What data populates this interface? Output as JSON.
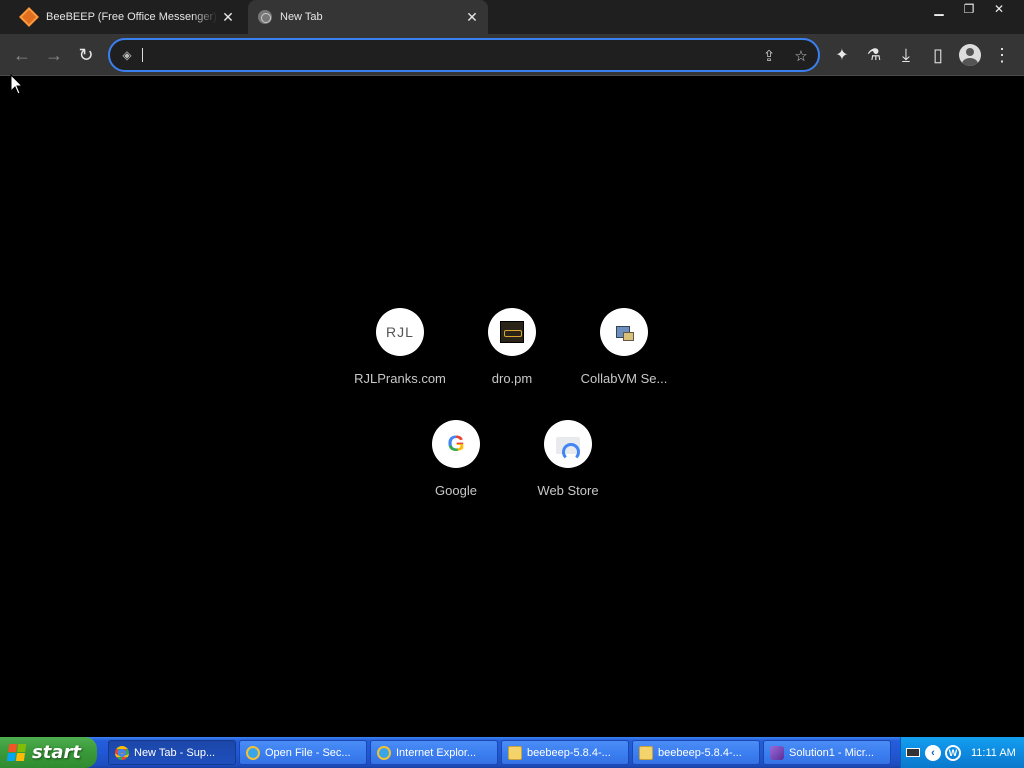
{
  "tabs": [
    {
      "title": "BeeBEEP (Free Office Messenger) d",
      "icon": "beebeep-icon",
      "active": false
    },
    {
      "title": "New Tab",
      "icon": "globe-icon",
      "active": true
    }
  ],
  "window_controls": {
    "minimize": "▁",
    "restore": "❐",
    "close": "✕"
  },
  "toolbar": {
    "back": "←",
    "forward": "→",
    "reload": "↻",
    "omnibox": {
      "value": "",
      "placeholder": ""
    },
    "share": "⇪",
    "bookmark": "☆",
    "extensions": "✦",
    "labs": "⚗",
    "downloads": "⤓",
    "side_panel": "▯",
    "menu": "⋮"
  },
  "shortcuts": [
    {
      "label": "RJLPranks.com",
      "tile_text": "RJL"
    },
    {
      "label": "dro.pm"
    },
    {
      "label": "CollabVM Se..."
    },
    {
      "label": "Google",
      "tile_text": "G"
    },
    {
      "label": "Web Store"
    }
  ],
  "taskbar": {
    "start_label": "start",
    "tasks": [
      {
        "label": "New Tab - Sup...",
        "icon": "chrome-icon",
        "active": true
      },
      {
        "label": "Open File - Sec...",
        "icon": "ie-icon",
        "active": false
      },
      {
        "label": "Internet Explor...",
        "icon": "ie-icon",
        "active": false
      },
      {
        "label": "beebeep-5.8.4-...",
        "icon": "folder-icon",
        "active": false
      },
      {
        "label": "beebeep-5.8.4-...",
        "icon": "folder-icon",
        "active": false
      },
      {
        "label": "Solution1 - Micr...",
        "icon": "visual-studio-icon",
        "active": false
      }
    ],
    "tray": {
      "chevron": "‹",
      "clock": "11:11 AM"
    }
  },
  "colors": {
    "omnibox_focus": "#3b80f0",
    "taskbar_blue": "#245edb",
    "start_green": "#3c9c3c",
    "page_background": "#000000"
  }
}
